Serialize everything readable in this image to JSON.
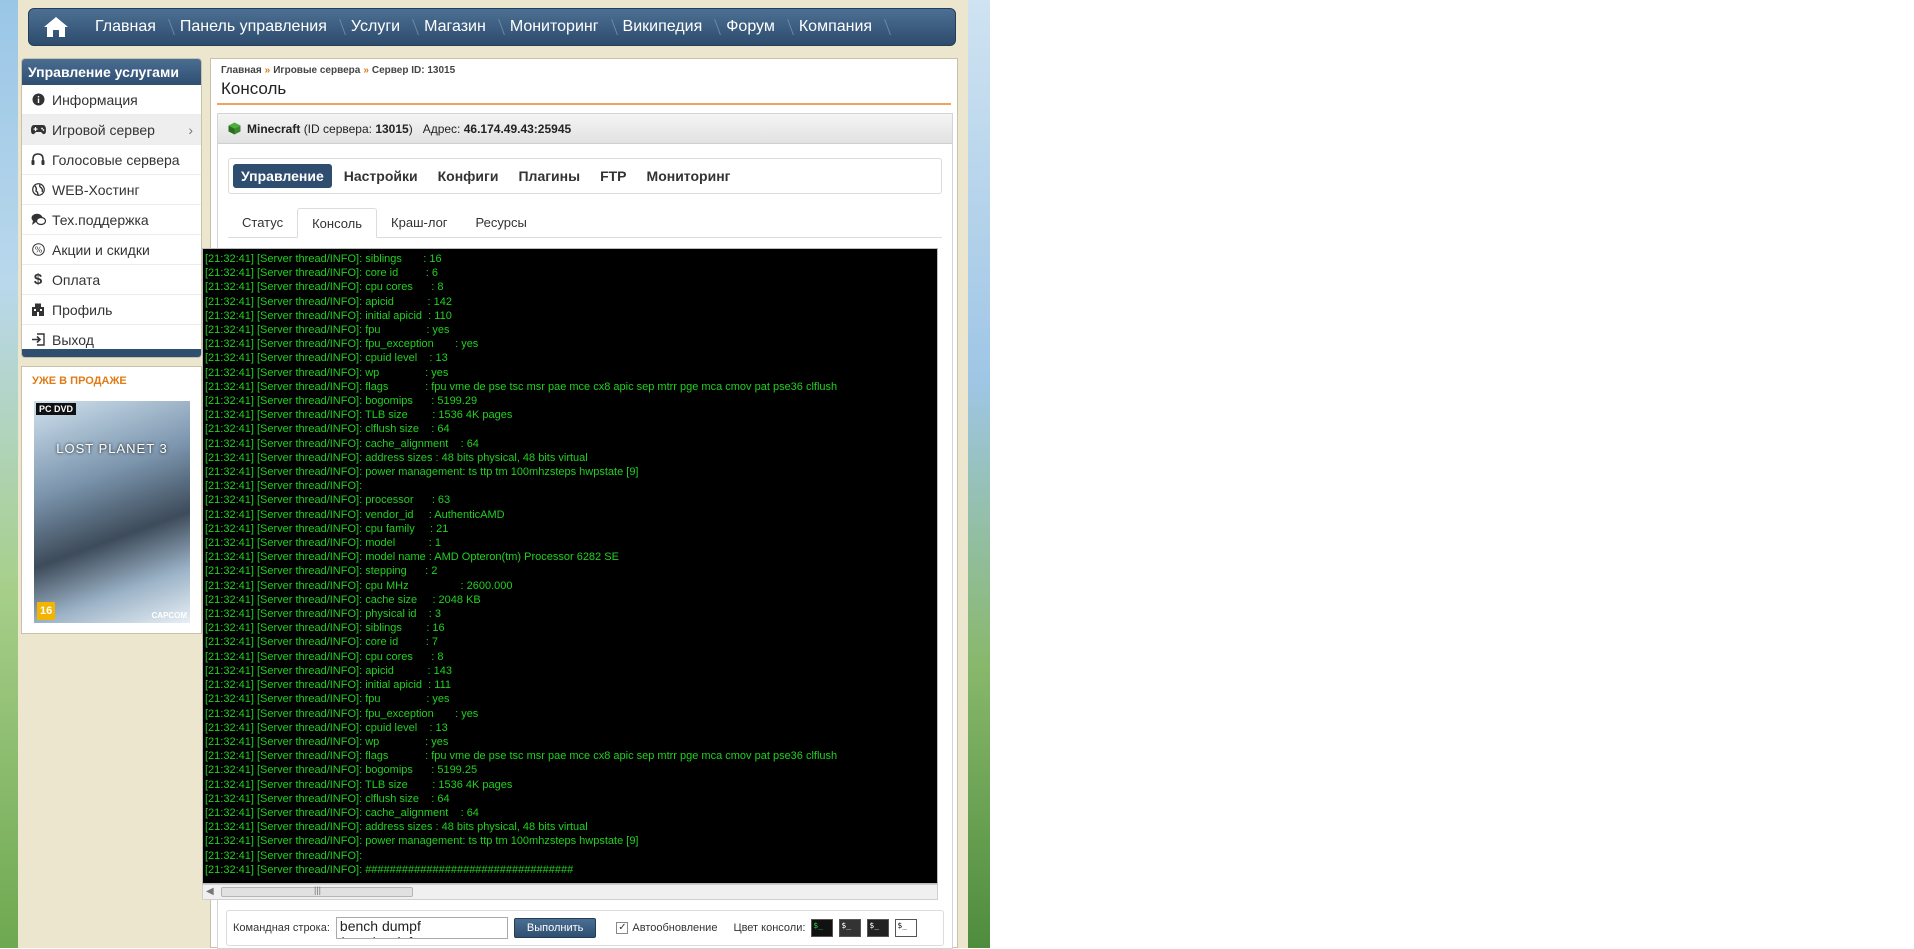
{
  "nav": {
    "items": [
      "Главная",
      "Панель управления",
      "Услуги",
      "Магазин",
      "Мониторинг",
      "Википедия",
      "Форум",
      "Компания"
    ]
  },
  "sidebar": {
    "title": "Управление услугами",
    "items": [
      {
        "label": "Информация",
        "icon": "info-icon"
      },
      {
        "label": "Игровой сервер",
        "icon": "gamepad-icon"
      },
      {
        "label": "Голосовые сервера",
        "icon": "headset-icon"
      },
      {
        "label": "WEB-Хостинг",
        "icon": "globe-icon"
      },
      {
        "label": "Тех.поддержка",
        "icon": "chat-icon"
      },
      {
        "label": "Акции и скидки",
        "icon": "percent-icon"
      },
      {
        "label": "Оплата",
        "icon": "dollar-icon"
      },
      {
        "label": "Профиль",
        "icon": "building-icon"
      },
      {
        "label": "Выход",
        "icon": "exit-icon"
      }
    ]
  },
  "promo": {
    "title": "УЖЕ В ПРОДАЖЕ",
    "cover_platform": "PC DVD",
    "cover_title": "LOST PLANET 3",
    "age": "16",
    "publisher": "CAPCOM"
  },
  "breadcrumb": [
    "Главная",
    "Игровые сервера",
    "Сервер ID: 13015"
  ],
  "page_title": "Консоль",
  "server": {
    "game": "Minecraft",
    "id_prefix": "(ID сервера:",
    "id": "13015",
    "id_suffix": ")",
    "address_label": "Адрес:",
    "address": "46.174.49.43:25945"
  },
  "tabs": [
    "Управление",
    "Настройки",
    "Конфиги",
    "Плагины",
    "FTP",
    "Мониторинг"
  ],
  "subtabs": [
    "Статус",
    "Консоль",
    "Краш-лог",
    "Ресурсы"
  ],
  "console": {
    "lines": [
      "[21:32:41] [Server thread/INFO]: siblings       : 16",
      "[21:32:41] [Server thread/INFO]: core id         : 6",
      "[21:32:41] [Server thread/INFO]: cpu cores      : 8",
      "[21:32:41] [Server thread/INFO]: apicid           : 142",
      "[21:32:41] [Server thread/INFO]: initial apicid  : 110",
      "[21:32:41] [Server thread/INFO]: fpu               : yes",
      "[21:32:41] [Server thread/INFO]: fpu_exception       : yes",
      "[21:32:41] [Server thread/INFO]: cpuid level    : 13",
      "[21:32:41] [Server thread/INFO]: wp               : yes",
      "[21:32:41] [Server thread/INFO]: flags            : fpu vme de pse tsc msr pae mce cx8 apic sep mtrr pge mca cmov pat pse36 clflush",
      "[21:32:41] [Server thread/INFO]: bogomips      : 5199.29",
      "[21:32:41] [Server thread/INFO]: TLB size        : 1536 4K pages",
      "[21:32:41] [Server thread/INFO]: clflush size    : 64",
      "[21:32:41] [Server thread/INFO]: cache_alignment    : 64",
      "[21:32:41] [Server thread/INFO]: address sizes : 48 bits physical, 48 bits virtual",
      "[21:32:41] [Server thread/INFO]: power management: ts ttp tm 100mhzsteps hwpstate [9]",
      "[21:32:41] [Server thread/INFO]:",
      "[21:32:41] [Server thread/INFO]: processor      : 63",
      "[21:32:41] [Server thread/INFO]: vendor_id     : AuthenticAMD",
      "[21:32:41] [Server thread/INFO]: cpu family     : 21",
      "[21:32:41] [Server thread/INFO]: model           : 1",
      "[21:32:41] [Server thread/INFO]: model name : AMD Opteron(tm) Processor 6282 SE",
      "[21:32:41] [Server thread/INFO]: stepping      : 2",
      "[21:32:41] [Server thread/INFO]: cpu MHz                 : 2600.000",
      "[21:32:41] [Server thread/INFO]: cache size     : 2048 KB",
      "[21:32:41] [Server thread/INFO]: physical id    : 3",
      "[21:32:41] [Server thread/INFO]: siblings        : 16",
      "[21:32:41] [Server thread/INFO]: core id         : 7",
      "[21:32:41] [Server thread/INFO]: cpu cores      : 8",
      "[21:32:41] [Server thread/INFO]: apicid           : 143",
      "[21:32:41] [Server thread/INFO]: initial apicid  : 111",
      "[21:32:41] [Server thread/INFO]: fpu               : yes",
      "[21:32:41] [Server thread/INFO]: fpu_exception       : yes",
      "[21:32:41] [Server thread/INFO]: cpuid level    : 13",
      "[21:32:41] [Server thread/INFO]: wp               : yes",
      "[21:32:41] [Server thread/INFO]: flags            : fpu vme de pse tsc msr pae mce cx8 apic sep mtrr pge mca cmov pat pse36 clflush",
      "[21:32:41] [Server thread/INFO]: bogomips      : 5199.25",
      "[21:32:41] [Server thread/INFO]: TLB size        : 1536 4K pages",
      "[21:32:41] [Server thread/INFO]: clflush size    : 64",
      "[21:32:41] [Server thread/INFO]: cache_alignment    : 64",
      "[21:32:41] [Server thread/INFO]: address sizes : 48 bits physical, 48 bits virtual",
      "[21:32:41] [Server thread/INFO]: power management: ts ttp tm 100mhzsteps hwpstate [9]",
      "[21:32:41] [Server thread/INFO]:",
      "[21:32:41] [Server thread/INFO]: ##################################"
    ]
  },
  "command": {
    "label": "Командная строка:",
    "value": "bench dumpf /proc/cpuinfo",
    "run_label": "Выполнить",
    "autoupdate_label": "Автообновление",
    "autoupdate_checked": true,
    "color_label": "Цвет консоли:",
    "swatch_text": "$_"
  }
}
